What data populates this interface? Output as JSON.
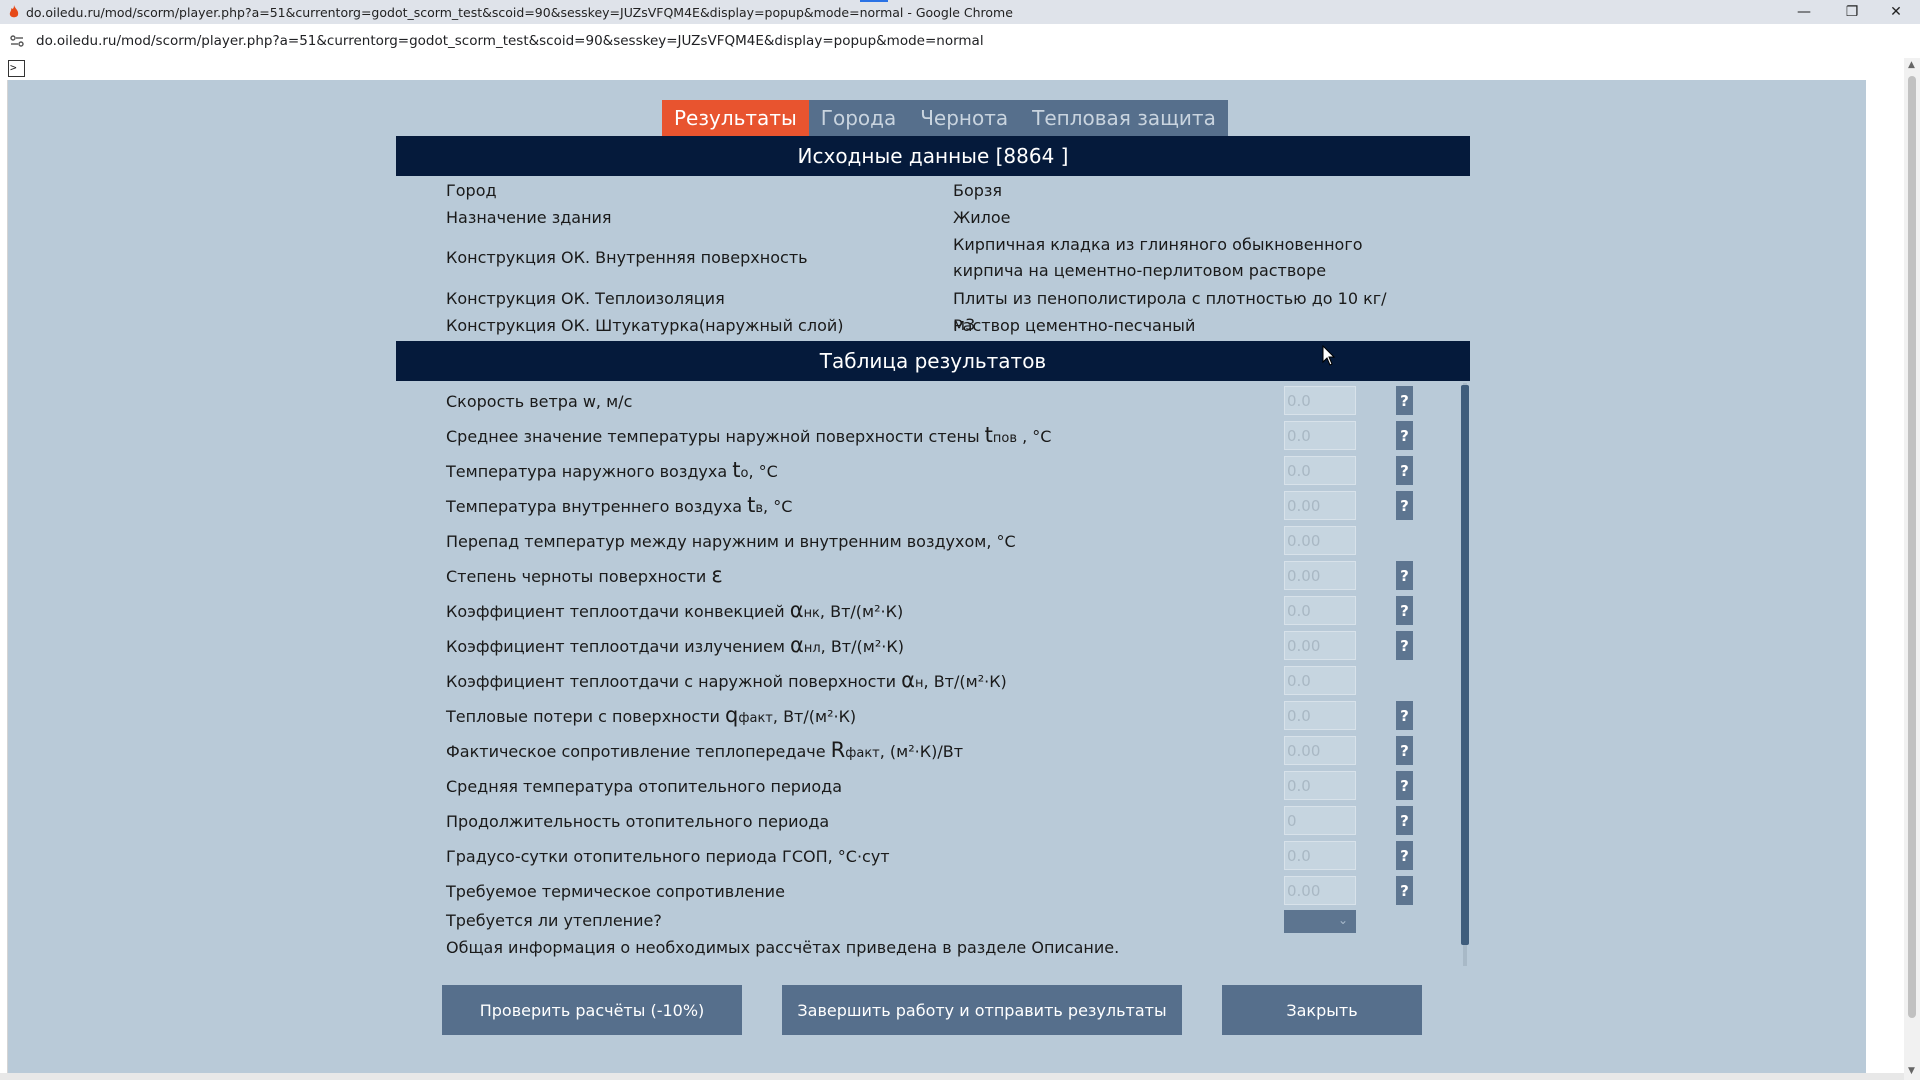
{
  "browser": {
    "window_title": "do.oiledu.ru/mod/scorm/player.php?a=51&currentorg=godot_scorm_test&scoid=90&sesskey=JUZsVFQM4E&display=popup&mode=normal - Google Chrome",
    "url": "do.oiledu.ru/mod/scorm/player.php?a=51&currentorg=godot_scorm_test&scoid=90&sesskey=JUZsVFQM4E&display=popup&mode=normal",
    "minimize_symbol": "—",
    "restore_symbol": "❐",
    "close_symbol": "✕",
    "prompt_symbol": ">",
    "accent_color": "#2a72e5"
  },
  "tabs": [
    {
      "label": "Результаты",
      "active": true
    },
    {
      "label": "Города",
      "active": false
    },
    {
      "label": "Чернота",
      "active": false
    },
    {
      "label": "Тепловая защита",
      "active": false
    }
  ],
  "source_data": {
    "title": "Исходные данные [8864 ]",
    "rows": [
      {
        "label": "Город",
        "value": "Борзя"
      },
      {
        "label": "Назначение здания",
        "value": "Жилое"
      },
      {
        "label": "Конструкция ОК. Внутренняя поверхность",
        "value": "Кирпичная кладка из глиняного обыкновенного кирпича на цементно-перлитовом растворе"
      },
      {
        "label": "Конструкция ОК. Теплоизоляция",
        "value": "Плиты из пенополистирола с плотностью до 10 кг/м3"
      },
      {
        "label": "Конструкция ОК. Штукатурка(наружный слой)",
        "value": "Раствор цементно-песчаный"
      }
    ]
  },
  "results": {
    "title": "Таблица результатов",
    "help_label": "?",
    "rows": [
      {
        "text": "Скорость ветра w, м/с",
        "sym": "",
        "sub": "",
        "tail": "",
        "value": "0.0",
        "help": true
      },
      {
        "text": "Среднее значение температуры наружной поверхности стены ",
        "sym": "t",
        "sub": "пов",
        "tail": " , °C",
        "value": "0.0",
        "help": true
      },
      {
        "text": "Температура наружного воздуха ",
        "sym": "t",
        "sub": "о",
        "tail": ", °C",
        "value": "0.0",
        "help": true
      },
      {
        "text": "Температура внутреннего воздуха ",
        "sym": "t",
        "sub": "в",
        "tail": ", °C",
        "value": "0.00",
        "help": true
      },
      {
        "text": "Перепад температур между наружним и внутренним воздухом, °C",
        "sym": "",
        "sub": "",
        "tail": "",
        "value": "0.00",
        "help": false
      },
      {
        "text": "Степень черноты поверхности ",
        "sym": "ε",
        "sub": "",
        "tail": "",
        "value": "0.00",
        "help": true
      },
      {
        "text": "Коэффициент теплоотдачи конвекцией ",
        "sym": "α",
        "sub": "нк",
        "tail": ", Вт/(м²·К)",
        "value": "0.0",
        "help": true
      },
      {
        "text": "Коэффициент теплоотдачи излучением ",
        "sym": "α",
        "sub": "нл",
        "tail": ", Вт/(м²·К)",
        "value": "0.00",
        "help": true
      },
      {
        "text": "Коэффициент теплоотдачи с наружной поверхности ",
        "sym": "α",
        "sub": "н",
        "tail": ", Вт/(м²·К)",
        "value": "0.0",
        "help": false
      },
      {
        "text": "Тепловые потери с поверхности ",
        "sym": "q",
        "sub": "факт",
        "tail": ", Вт/(м²·К)",
        "value": "0.0",
        "help": true
      },
      {
        "text": "Фактическое сопротивление теплопередаче ",
        "sym": "R",
        "sub": "факт",
        "tail": ", (м²·К)/Вт",
        "value": "0.00",
        "help": true
      },
      {
        "text": "Средняя температура отопительного периода",
        "sym": "",
        "sub": "",
        "tail": "",
        "value": "0.0",
        "help": true
      },
      {
        "text": "Продолжительность отопительного периода",
        "sym": "",
        "sub": "",
        "tail": "",
        "value": "0",
        "help": true
      },
      {
        "text": "Градусо-сутки отопительного периода ГСОП, °С·сут",
        "sym": "",
        "sub": "",
        "tail": "",
        "value": "0.0",
        "help": true
      },
      {
        "text": "Требуемое термическое сопротивление",
        "sym": "",
        "sub": "",
        "tail": "",
        "value": "0.00",
        "help": true
      }
    ],
    "insulation_question": "Требуется ли утепление?",
    "insulation_selected": "",
    "info_text": "Общая информация о необходимых рассчётах приведена в разделе Описание."
  },
  "actions": {
    "check": "Проверить расчёты (-10%)",
    "finish": "Завершить работу и отправить результаты",
    "close": "Закрыть"
  },
  "colors": {
    "canvas_bg": "#b9cad8",
    "header_bg": "#051a3b",
    "active_tab": "#e8542f",
    "tab_bar": "#566f8c",
    "button_bg": "#566f8c"
  }
}
